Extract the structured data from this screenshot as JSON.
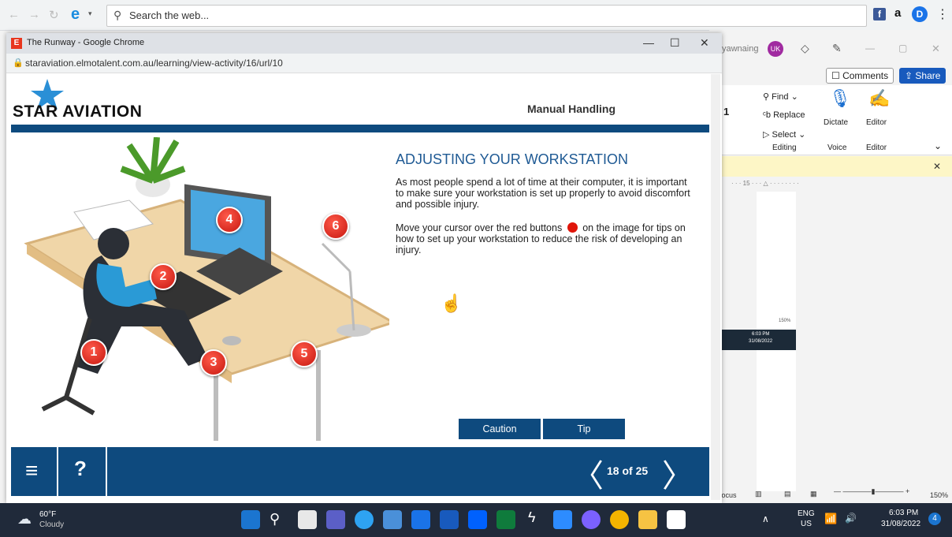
{
  "browser": {
    "search_placeholder": "Search the web..."
  },
  "popup": {
    "title": "The Runway - Google Chrome",
    "url": "staraviation.elmotalent.com.au/learning/view-activity/16/url/10"
  },
  "course": {
    "brand": "STAR AVIATION",
    "title": "Manual Handling",
    "heading": "ADJUSTING YOUR WORKSTATION",
    "para1": "As most people spend a lot of time at their computer, it is important to make sure your workstation is set up properly to avoid discomfort and possible injury.",
    "para2_a": "Move your cursor over the red buttons",
    "para2_b": "on the image for tips on how to set up your workstation to reduce the risk of developing an injury.",
    "caution_label": "Caution",
    "tip_label": "Tip",
    "pager": "18 of 25",
    "help_label": "?",
    "markers": [
      "1",
      "2",
      "3",
      "4",
      "5",
      "6"
    ]
  },
  "word": {
    "user_name": "yawnaing",
    "user_initials": "UK",
    "comments_label": "Comments",
    "share_label": "Share",
    "find_label": "Find",
    "replace_label": "Replace",
    "select_label": "Select",
    "editing_label": "Editing",
    "dictate_label": "Dictate",
    "voice_label": "Voice",
    "editor_label": "Editor",
    "editor_group_label": "Editor",
    "font_size": "1",
    "zoom": "150%",
    "focus_label": "Focus",
    "ruler": "· · · 15 · · · △ · · · · · · · ·",
    "mini_time": "6:03 PM",
    "mini_date": "31/08/2022",
    "mini_zoom": "150%"
  },
  "taskbar": {
    "temp": "60°F",
    "weather": "Cloudy",
    "lang1": "ENG",
    "lang2": "US",
    "time": "6:03 PM",
    "date": "31/08/2022",
    "notifications": "4",
    "icon_colors": [
      "#1b75d0",
      "#2ea3f2",
      "#4a90d9",
      "#0f7b3c",
      "#1a73e8",
      "#7b61ff",
      "#f4b400",
      "#f6c343",
      "#ffffff"
    ]
  }
}
